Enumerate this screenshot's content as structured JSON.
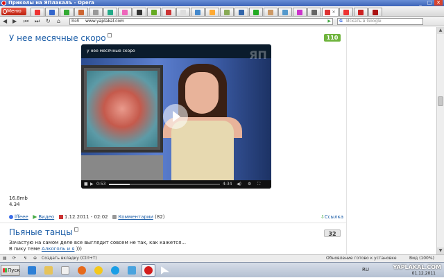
{
  "window": {
    "title": "Приколы на ЯПлакалъ - Opera",
    "controls": [
      "_",
      "□",
      "✕"
    ]
  },
  "browser": {
    "menu_label": "Меню",
    "tab_count": 24,
    "active_tab_index": 20,
    "url_prefix": "Веб",
    "url": "www.yaplakal.com",
    "search_placeholder": "Искать в Google"
  },
  "posts": [
    {
      "title": "У нее месячные скоро",
      "score": "110",
      "score_color": "#6fb43d",
      "video": {
        "title": "у нее месячные скоро",
        "time_current": "0:53",
        "time_total": "4:34",
        "progress": 0.19
      },
      "size": "16.8mb",
      "duration": "4.34",
      "author": "lffeee",
      "category": "Видео",
      "date": "1.12.2011 - 02:02",
      "comments_label": "Комментарии",
      "comments_count": "(82)",
      "link_label": "Ссылка"
    },
    {
      "title": "Пьяные танцы",
      "score": "32",
      "text_line1": "Зачастую на самом деле все выглядит совсем не так, как кажется...",
      "text_line2_prefix": "В пику теме",
      "text_line2_link": "Алкоголь и я",
      "text_line2_suffix": ")))"
    }
  ],
  "status_bar": {
    "new_tab_hint": "Создать вкладку (Ctrl+T)",
    "status": "Обновление готово к установке",
    "view_label": "Вид (100%)"
  },
  "taskbar": {
    "start_label": "Пуск",
    "lang": "RU",
    "watermark": "YAPLAKAL.COM",
    "date": "01.12.2011"
  }
}
